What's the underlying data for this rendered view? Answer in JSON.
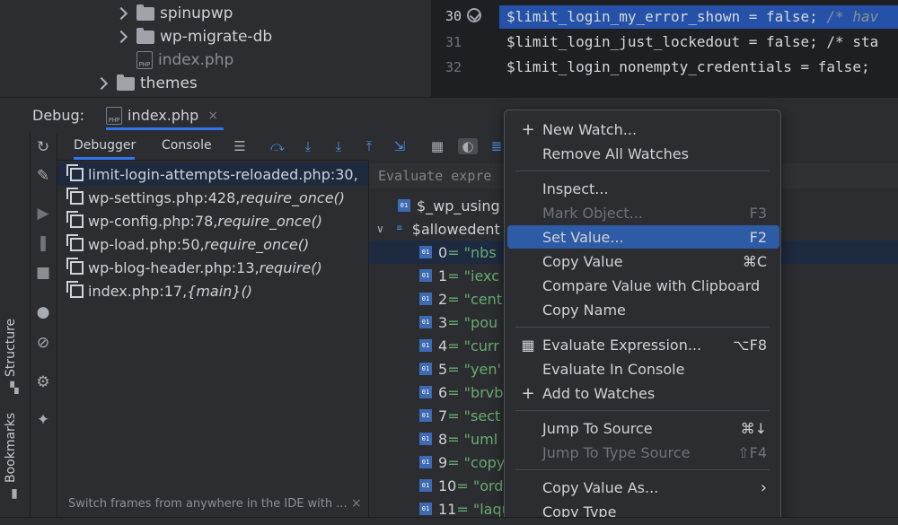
{
  "project_tree": {
    "items": [
      {
        "label": "spinupwp",
        "type": "folder"
      },
      {
        "label": "wp-migrate-db",
        "type": "folder"
      },
      {
        "label": "index.php",
        "type": "file"
      },
      {
        "label": "themes",
        "type": "folder"
      }
    ]
  },
  "editor": {
    "lines": [
      {
        "num": "30",
        "code": "$limit_login_my_error_shown = false; ",
        "comment": "/* hav"
      },
      {
        "num": "31",
        "code": "$limit_login_just_lockedout = false; /* sta",
        "comment": ""
      },
      {
        "num": "32",
        "code": "$limit_login_nonempty_credentials = false;",
        "comment": ""
      }
    ]
  },
  "debug": {
    "label": "Debug:",
    "tab_name": "index.php",
    "close_glyph": "×"
  },
  "sidebar": {
    "structure_label": "Structure",
    "bookmarks_label": "Bookmarks"
  },
  "debugger_tabs": {
    "debugger": "Debugger",
    "console": "Console"
  },
  "frames": [
    {
      "file": "limit-login-attempts-reloaded.php:30,",
      "call": ""
    },
    {
      "file": "wp-settings.php:428, ",
      "call": "require_once()"
    },
    {
      "file": "wp-config.php:78, ",
      "call": "require_once()"
    },
    {
      "file": "wp-load.php:50, ",
      "call": "require_once()"
    },
    {
      "file": "wp-blog-header.php:13, ",
      "call": "require()"
    },
    {
      "file": "index.php:17, ",
      "call": "{main}()"
    }
  ],
  "frames_hint": "Switch frames from anywhere in the IDE with ...",
  "frames_hint_close": "×",
  "variables": {
    "eval_placeholder": "Evaluate expre",
    "items": [
      {
        "name": "$_wp_using",
        "value": ""
      },
      {
        "name": "$allowedent",
        "value": ""
      },
      {
        "name": "0",
        "value": " = \"nbs"
      },
      {
        "name": "1",
        "value": " = \"iexc"
      },
      {
        "name": "2",
        "value": " = \"cent"
      },
      {
        "name": "3",
        "value": " = \"pou"
      },
      {
        "name": "4",
        "value": " = \"curr"
      },
      {
        "name": "5",
        "value": " = \"yen'"
      },
      {
        "name": "6",
        "value": " = \"brvb"
      },
      {
        "name": "7",
        "value": " = \"sect"
      },
      {
        "name": "8",
        "value": " = \"uml"
      },
      {
        "name": "9",
        "value": " = \"copy"
      },
      {
        "name": "10",
        "value": " = \"ord"
      },
      {
        "name": "11",
        "value": " = \"laqu"
      }
    ]
  },
  "context_menu": {
    "items": [
      {
        "label": "New Watch...",
        "shortcut": "",
        "icon": "plus-icon",
        "enabled": true
      },
      {
        "label": "Remove All Watches",
        "shortcut": "",
        "icon": "",
        "enabled": true
      },
      {
        "label": "Inspect...",
        "shortcut": "",
        "icon": "",
        "enabled": true
      },
      {
        "label": "Mark Object...",
        "shortcut": "F3",
        "icon": "",
        "enabled": false
      },
      {
        "label": "Set Value...",
        "shortcut": "F2",
        "icon": "",
        "enabled": true
      },
      {
        "label": "Copy Value",
        "shortcut": "⌘C",
        "icon": "",
        "enabled": true
      },
      {
        "label": "Compare Value with Clipboard",
        "shortcut": "",
        "icon": "",
        "enabled": true
      },
      {
        "label": "Copy Name",
        "shortcut": "",
        "icon": "",
        "enabled": true
      },
      {
        "label": "Evaluate Expression...",
        "shortcut": "⌥F8",
        "icon": "calculator-icon",
        "enabled": true
      },
      {
        "label": "Evaluate In Console",
        "shortcut": "",
        "icon": "",
        "enabled": true
      },
      {
        "label": "Add to Watches",
        "shortcut": "",
        "icon": "add-watch-icon",
        "enabled": true
      },
      {
        "label": "Jump To Source",
        "shortcut": "⌘↓",
        "icon": "",
        "enabled": true
      },
      {
        "label": "Jump To Type Source",
        "shortcut": "⇧F4",
        "icon": "",
        "enabled": false
      },
      {
        "label": "Copy Value As...",
        "shortcut": "›",
        "icon": "",
        "enabled": true
      },
      {
        "label": "Copy Type",
        "shortcut": "",
        "icon": "",
        "enabled": true
      }
    ]
  },
  "colors": {
    "accent": "#3574f0",
    "selection": "#2e5ba6",
    "editor_highlight": "#2552a8"
  }
}
